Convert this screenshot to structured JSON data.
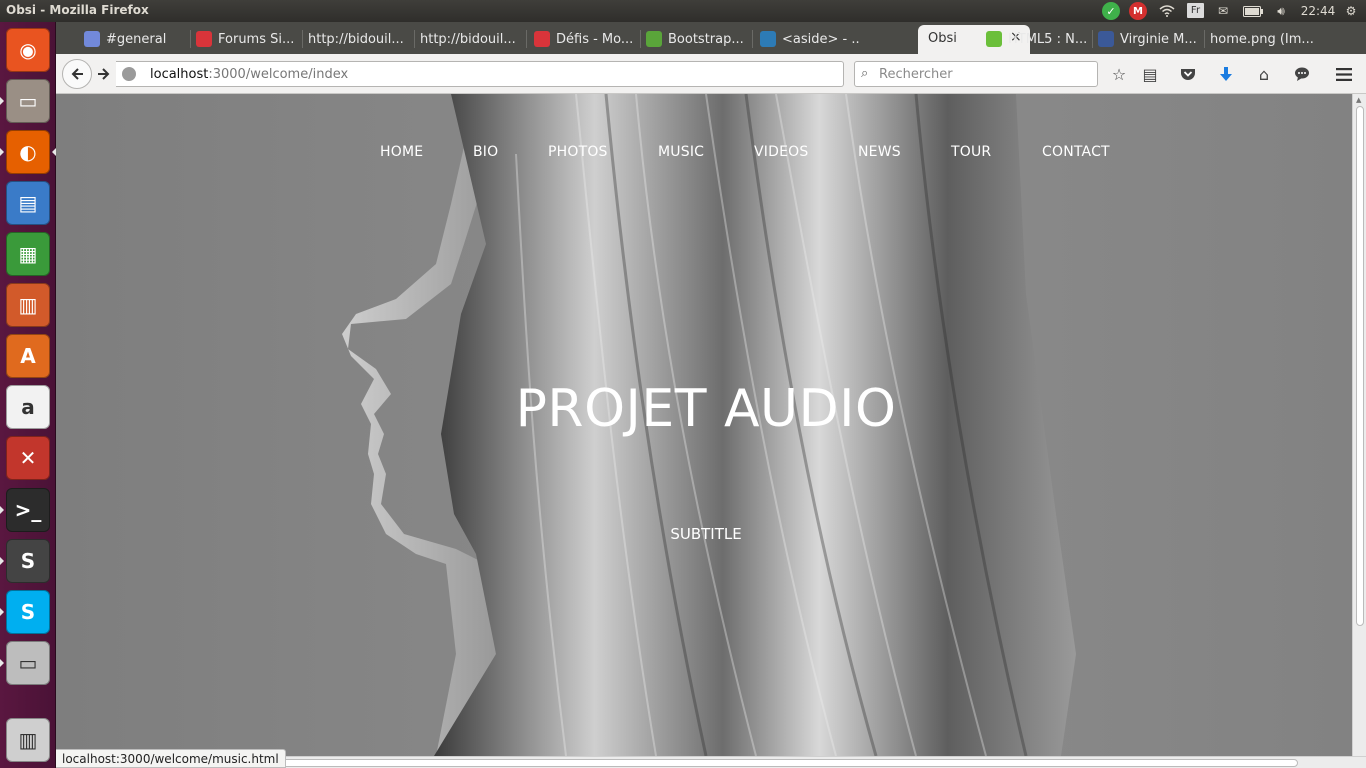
{
  "window": {
    "title": "Obsi - Mozilla Firefox"
  },
  "top_panel": {
    "clock": "22:44",
    "keyboard_layout": "Fr",
    "indicators": [
      "check-icon",
      "mail-m-icon",
      "wifi-icon",
      "keyboard-layout-indicator",
      "envelope-icon",
      "battery-icon",
      "volume-icon",
      "gear-icon"
    ]
  },
  "launcher": {
    "items": [
      {
        "name": "ubuntu-dash-icon",
        "glyph": "◉",
        "color": "#e95420"
      },
      {
        "name": "files-icon",
        "glyph": "▭",
        "color": "#9a8f85"
      },
      {
        "name": "firefox-icon",
        "glyph": "◐",
        "color": "#e66000"
      },
      {
        "name": "writer-icon",
        "glyph": "▤",
        "color": "#3a7bc8"
      },
      {
        "name": "calc-icon",
        "glyph": "▦",
        "color": "#3a9a3a"
      },
      {
        "name": "impress-icon",
        "glyph": "▥",
        "color": "#d25a2a"
      },
      {
        "name": "software-center-icon",
        "glyph": "A",
        "color": "#e06a1e"
      },
      {
        "name": "amazon-icon",
        "glyph": "a",
        "color": "#f2f2f2"
      },
      {
        "name": "system-settings-icon",
        "glyph": "✕",
        "color": "#c2362c"
      },
      {
        "name": "terminal-icon",
        "glyph": ">_",
        "color": "#2c2c2c"
      },
      {
        "name": "sublime-text-icon",
        "glyph": "S",
        "color": "#444"
      },
      {
        "name": "skype-icon",
        "glyph": "S",
        "color": "#00aff0"
      },
      {
        "name": "printer-icon",
        "glyph": "▭",
        "color": "#bdbdbd"
      },
      {
        "name": "trash-icon",
        "glyph": "▥",
        "color": "#cfcfcf"
      }
    ]
  },
  "browser": {
    "tabs": [
      {
        "label": "#general",
        "icon": "discord-icon",
        "icon_color": "#7289da"
      },
      {
        "label": "Forums Si...",
        "icon": "forum-icon",
        "icon_color": "#d9343a"
      },
      {
        "label": "http://bidouil...",
        "icon": "",
        "icon_color": ""
      },
      {
        "label": "http://bidouil...",
        "icon": "",
        "icon_color": ""
      },
      {
        "label": "Défis - Mo...",
        "icon": "forum-icon",
        "icon_color": "#d9343a"
      },
      {
        "label": "Bootstrap...",
        "icon": "chart-icon",
        "icon_color": "#5aa53a"
      },
      {
        "label": "<aside> - ...",
        "icon": "mdn-icon",
        "icon_color": "#2d7bb6"
      },
      {
        "label": "HTML5 : N...",
        "icon": "leaf-icon",
        "icon_color": "#6bbf3a"
      },
      {
        "label": "Virginie M...",
        "icon": "facebook-icon",
        "icon_color": "#3b5998"
      },
      {
        "label": "home.png (Im...",
        "icon": "",
        "icon_color": ""
      }
    ],
    "active_tab": {
      "label": "Obsi",
      "close": "×"
    },
    "url": {
      "host": "localhost",
      "path": ":3000/welcome/index"
    },
    "search": {
      "placeholder": "Rechercher"
    },
    "status_link": "localhost:3000/welcome/music.html"
  },
  "page": {
    "nav": [
      "HOME",
      "BIO",
      "PHOTOS",
      "MUSIC",
      "VIDEOS",
      "NEWS",
      "TOUR",
      "CONTACT"
    ],
    "title": "PROJET AUDIO",
    "subtitle": "SUBTITLE"
  }
}
